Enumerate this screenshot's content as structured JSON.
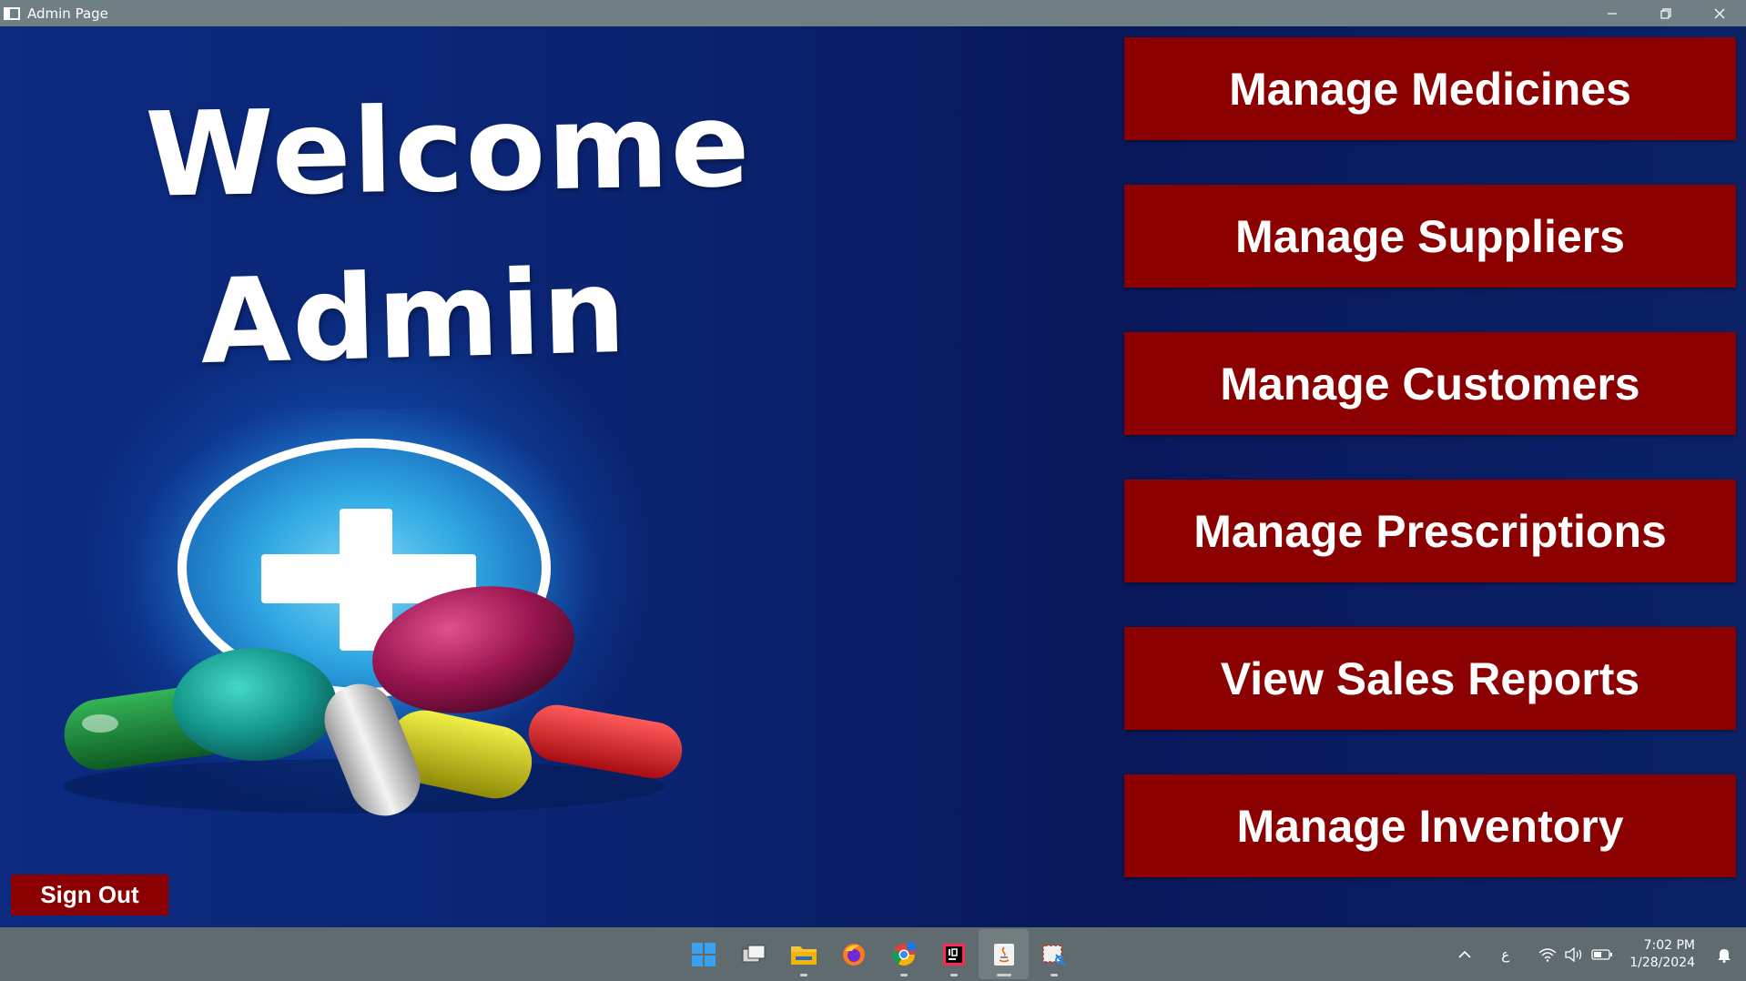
{
  "window": {
    "title": "Admin Page",
    "icon": "app-window-icon",
    "controls": [
      "minimize-icon",
      "restore-icon",
      "close-icon"
    ]
  },
  "hero": {
    "welcome_text": "Welcome",
    "admin_text": "Admin",
    "image": "pharmacy-cross-and-pills-illustration"
  },
  "menu": {
    "items": [
      {
        "label": "Manage Medicines"
      },
      {
        "label": "Manage Suppliers"
      },
      {
        "label": "Manage Customers"
      },
      {
        "label": "Manage Prescriptions"
      },
      {
        "label": "View Sales Reports"
      },
      {
        "label": "Manage Inventory"
      }
    ]
  },
  "signout": {
    "label": "Sign Out"
  },
  "taskbar": {
    "apps": [
      "windows-start-icon",
      "task-view-icon",
      "file-explorer-icon",
      "firefox-icon",
      "chrome-icon",
      "intellij-icon",
      "java-icon",
      "snipping-tool-icon"
    ],
    "tray": {
      "language": "ع",
      "time": "7:02 PM",
      "date": "1/28/2024"
    }
  },
  "colors": {
    "button_red": "#8b0000",
    "background_blue": "#0a236f",
    "titlebar": "#6f7f83",
    "taskbar": "#5f6b6e"
  }
}
